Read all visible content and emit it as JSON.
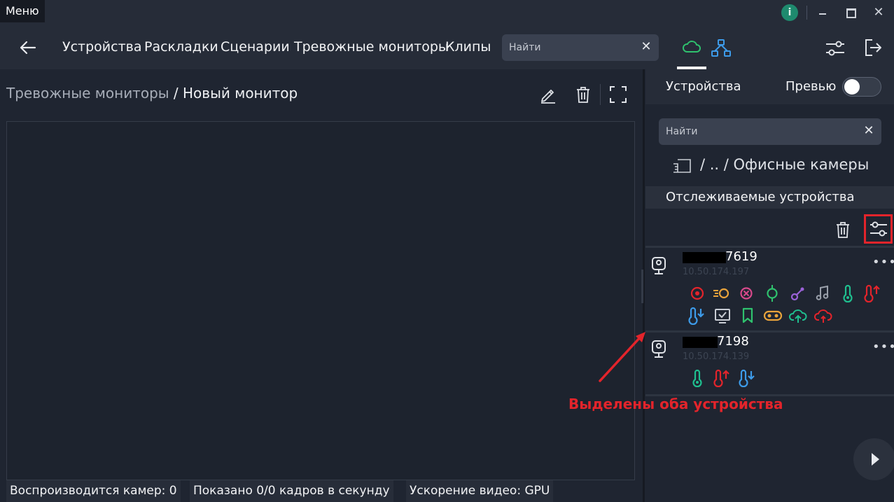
{
  "titlebar": {
    "menu_label": "Меню",
    "info_label": "i"
  },
  "nav": {
    "items": [
      "Устройства",
      "Раскладки",
      "Сценарии",
      "Тревожные мониторы",
      "Клипы"
    ],
    "search_placeholder": "Найти"
  },
  "main": {
    "breadcrumb_parent": "Тревожные мониторы",
    "breadcrumb_sep": " / ",
    "breadcrumb_current": "Новый монитор",
    "status": [
      "Воспроизводится камер: 0",
      "Показано 0/0 кадров в секунду",
      "Ускорение видео: GPU"
    ]
  },
  "right_panel": {
    "title": "Устройства",
    "preview_label": "Превью",
    "preview_on": false,
    "search_placeholder": "Найти",
    "path": "/ .. / Офисные камеры",
    "section_title": "Отслеживаемые устройства",
    "devices": [
      {
        "id_suffix": "7619",
        "ip": "10.50.174.197",
        "icons": [
          "target-icon",
          "motion-icon",
          "tamper-icon",
          "gpio-icon",
          "audio-link-icon",
          "music-icon",
          "thermometer-icon",
          "temperature-up-icon",
          "temperature-down-icon",
          "screen-check-icon",
          "bookmark-icon",
          "toggle-icon",
          "cloud-upload-icon",
          "cloud-error-icon"
        ]
      },
      {
        "id_suffix": "7198",
        "ip": "10.50.174.139",
        "icons": [
          "thermometer-icon",
          "temperature-up-icon",
          "temperature-down-icon"
        ]
      }
    ]
  },
  "annotation": {
    "text": "Выделены оба устройства"
  },
  "colors": {
    "background": "#1f2531",
    "bar": "#262c38",
    "accent_green": "#2fc26e",
    "accent_blue": "#3d9be9",
    "highlight_red": "#e3242b"
  }
}
